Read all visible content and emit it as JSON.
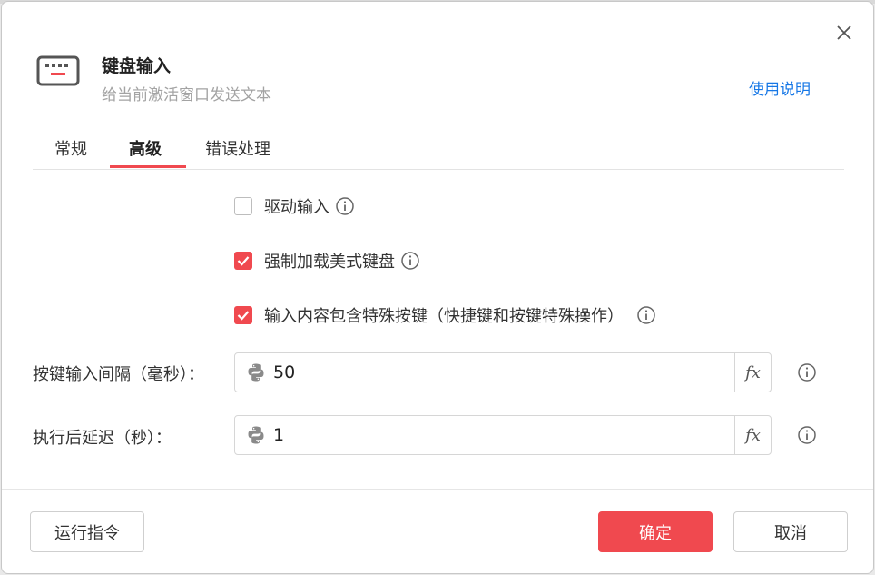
{
  "dialog": {
    "title": "键盘输入",
    "subtitle": "给当前激活窗口发送文本",
    "help_link": "使用说明",
    "icon": "keyboard-icon"
  },
  "tabs": [
    {
      "label": "常规",
      "active": false
    },
    {
      "label": "高级",
      "active": true
    },
    {
      "label": "错误处理",
      "active": false
    }
  ],
  "options": [
    {
      "label": "驱动输入",
      "checked": false
    },
    {
      "label": "强制加载美式键盘",
      "checked": true
    },
    {
      "label": "输入内容包含特殊按键（快捷键和按键特殊操作）",
      "checked": true
    }
  ],
  "fields": [
    {
      "label": "按键输入间隔（毫秒）：",
      "value": "50"
    },
    {
      "label": "执行后延迟（秒）：",
      "value": "1"
    }
  ],
  "fx_label": "fx",
  "footer": {
    "run_label": "运行指令",
    "confirm_label": "确定",
    "cancel_label": "取消"
  },
  "colors": {
    "accent": "#f0494f",
    "link": "#1677e6"
  }
}
